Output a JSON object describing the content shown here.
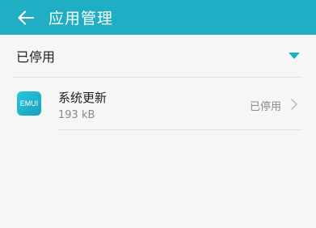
{
  "header": {
    "title": "应用管理",
    "back_icon": "arrow-left-icon"
  },
  "section": {
    "title": "已停用",
    "caret_icon": "caret-down-icon"
  },
  "apps": [
    {
      "name": "系统更新",
      "size": "193 kB",
      "status": "已停用",
      "icon_text": "EMUI",
      "icon": "emui-app-icon"
    }
  ],
  "colors": {
    "accent": "#1faec3",
    "background": "#f6f6f6",
    "primary_text": "#202020",
    "secondary_text": "#8a8a8a",
    "divider": "#e0e0e0"
  }
}
